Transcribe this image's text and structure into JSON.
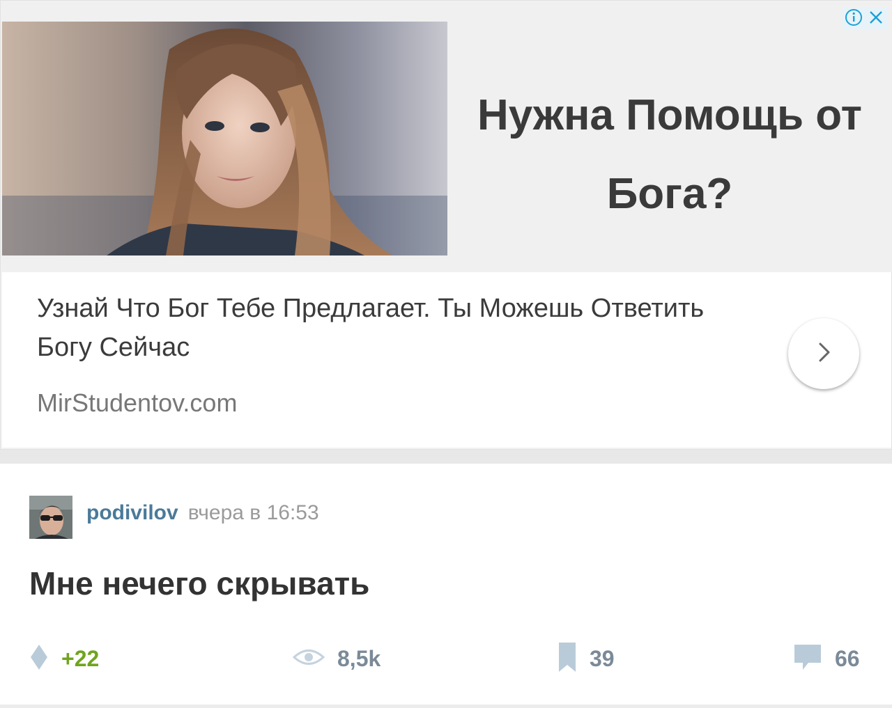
{
  "ad": {
    "headline": "Нужна Помощь от Бога?",
    "description": "Узнай Что Бог Тебе Предлагает. Ты Можешь Ответить Богу Сейчас",
    "domain": "MirStudentov.com",
    "info_icon": "info-icon",
    "close_icon": "close-icon",
    "next_icon": "chevron-right-icon"
  },
  "post": {
    "author": "podivilov",
    "time": "вчера в 16:53",
    "title": "Мне нечего скрывать",
    "stats": {
      "rating": "+22",
      "views": "8,5k",
      "bookmarks": "39",
      "comments": "66"
    }
  },
  "colors": {
    "rating": "#6fa51e",
    "author": "#4b7a9a",
    "stat_icons": "#b9cbd9",
    "ad_badge": "#1aa0d8"
  }
}
